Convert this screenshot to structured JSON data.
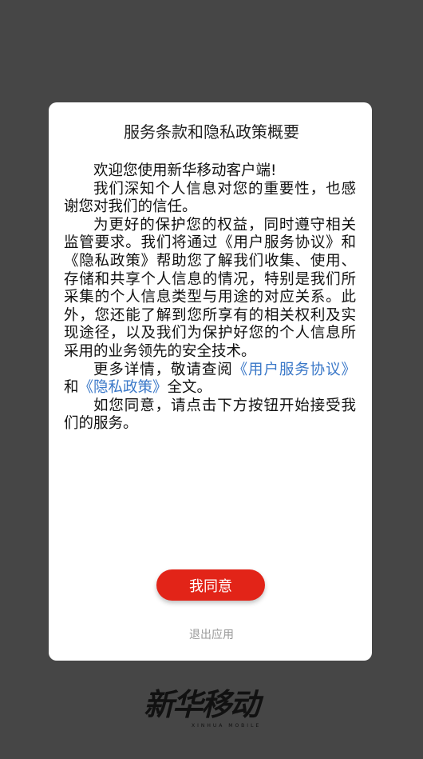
{
  "dialog": {
    "title": "服务条款和隐私政策概要",
    "paragraphs": {
      "p1": "欢迎您使用新华移动客户端!",
      "p2": "我们深知个人信息对您的重要性，也感谢您对我们的信任。",
      "p3": "为更好的保护您的权益，同时遵守相关监管要求。我们将通过《用户服务协议》和《隐私政策》帮助您了解我们收集、使用、存储和共享个人信息的情况，特别是我们所采集的个人信息类型与用途的对应关系。此外，您还能了解到您所享有的相关权利及实现途径，以及我们为保护好您的个人信息所采用的业务领先的安全技术。",
      "p4_prefix": "更多详情，敬请查阅",
      "p4_link1": "《用户服务协议》",
      "p4_mid": "和",
      "p4_link2": "《隐私政策》",
      "p4_suffix": "全文。",
      "p5": "如您同意，请点击下方按钮开始接受我们的服务。"
    },
    "agree_label": "我同意",
    "exit_label": "退出应用"
  },
  "logo": {
    "text": "新华移动",
    "subtitle": "XINHUA MOBILE"
  },
  "colors": {
    "background": "#464646",
    "accent": "#e22418",
    "link": "#3a78c8"
  }
}
